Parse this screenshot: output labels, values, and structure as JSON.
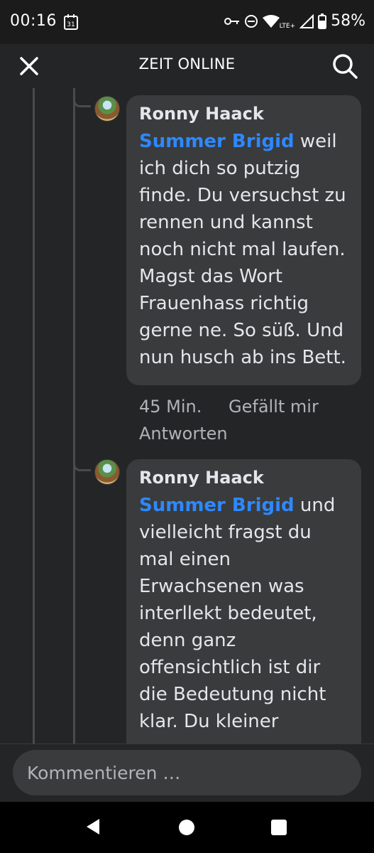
{
  "status_bar": {
    "time": "00:16",
    "calendar_day": "31",
    "battery": "58%",
    "network": "LTE+"
  },
  "app_bar": {
    "title": "ZEIT ONLINE"
  },
  "comments": [
    {
      "author": "Ronny Haack",
      "mention": "Summer Brigid",
      "text": " weil ich dich so putzig finde. Du versuchst zu rennen und kannst noch nicht mal laufen. Magst das Wort Frauenhass richtig gerne ne. So süß. Und nun husch ab ins Bett.",
      "time": "45 Min.",
      "like_label": "Gefällt mir",
      "reply_label": "Antworten"
    },
    {
      "author": "Ronny Haack",
      "mention": "Summer Brigid",
      "text": " und vielleicht fragst du mal einen Erwachsenen was interllekt bedeutet, denn ganz offensichtlich ist dir die Bedeutung nicht klar. Du kleiner"
    }
  ],
  "composer": {
    "placeholder": "Kommentieren …"
  },
  "colors": {
    "background": "#242526",
    "bubble": "#3a3b3c",
    "mention": "#2d88ff"
  }
}
